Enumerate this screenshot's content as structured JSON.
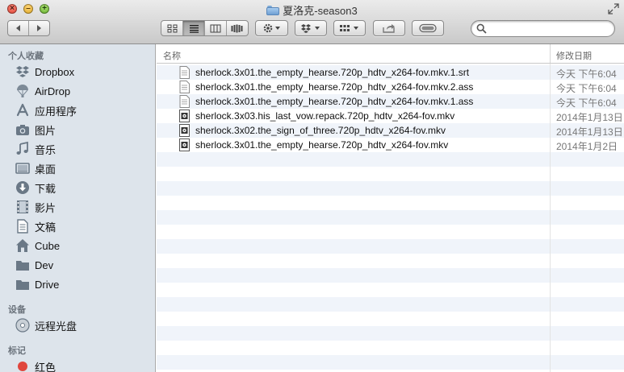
{
  "window": {
    "title": "夏洛克-season3"
  },
  "toolbar": {
    "back_label": "back",
    "forward_label": "forward",
    "view_modes": [
      "icon-view",
      "list-view",
      "column-view",
      "coverflow-view"
    ],
    "active_view": "list-view",
    "action_menu": "gear-icon",
    "dropbox_menu": "dropbox-icon",
    "arrange_menu": "arrange-icon",
    "share_button": "share-icon",
    "toggle_button": "tags-toggle-icon",
    "search": {
      "value": "",
      "placeholder": ""
    }
  },
  "sidebar": {
    "favorites_header": "个人收藏",
    "favorites": [
      {
        "label": "Dropbox",
        "icon": "dropbox-icon"
      },
      {
        "label": "AirDrop",
        "icon": "airdrop-icon"
      },
      {
        "label": "应用程序",
        "icon": "applications-icon"
      },
      {
        "label": "图片",
        "icon": "camera-icon"
      },
      {
        "label": "音乐",
        "icon": "music-icon"
      },
      {
        "label": "桌面",
        "icon": "desktop-icon"
      },
      {
        "label": "下载",
        "icon": "download-icon"
      },
      {
        "label": "影片",
        "icon": "movies-icon"
      },
      {
        "label": "文稿",
        "icon": "documents-icon"
      },
      {
        "label": "Cube",
        "icon": "home-icon"
      },
      {
        "label": "Dev",
        "icon": "folder-icon"
      },
      {
        "label": "Drive",
        "icon": "folder-icon"
      }
    ],
    "devices_header": "设备",
    "devices": [
      {
        "label": "远程光盘",
        "icon": "disc-icon"
      }
    ],
    "tags_header": "标记",
    "tags": [
      {
        "label": "红色",
        "color": "#e0463d"
      }
    ]
  },
  "list": {
    "columns": {
      "name": "名称",
      "date": "修改日期"
    },
    "files": [
      {
        "name": "sherlock.3x01.the_empty_hearse.720p_hdtv_x264-fov.mkv.1.srt",
        "date": "今天 下午6:04",
        "icon": "text-file-icon"
      },
      {
        "name": "sherlock.3x01.the_empty_hearse.720p_hdtv_x264-fov.mkv.2.ass",
        "date": "今天 下午6:04",
        "icon": "text-file-icon"
      },
      {
        "name": "sherlock.3x01.the_empty_hearse.720p_hdtv_x264-fov.mkv.1.ass",
        "date": "今天 下午6:04",
        "icon": "text-file-icon"
      },
      {
        "name": "sherlock.3x03.his_last_vow.repack.720p_hdtv_x264-fov.mkv",
        "date": "2014年1月13日",
        "icon": "video-file-icon"
      },
      {
        "name": "sherlock.3x02.the_sign_of_three.720p_hdtv_x264-fov.mkv",
        "date": "2014年1月13日",
        "icon": "video-file-icon"
      },
      {
        "name": "sherlock.3x01.the_empty_hearse.720p_hdtv_x264-fov.mkv",
        "date": "2014年1月2日",
        "icon": "video-file-icon"
      }
    ]
  },
  "colors": {
    "sidebar_bg": "#dde4eb",
    "stripe": "#f0f4fa",
    "tag_red": "#e0463d"
  }
}
